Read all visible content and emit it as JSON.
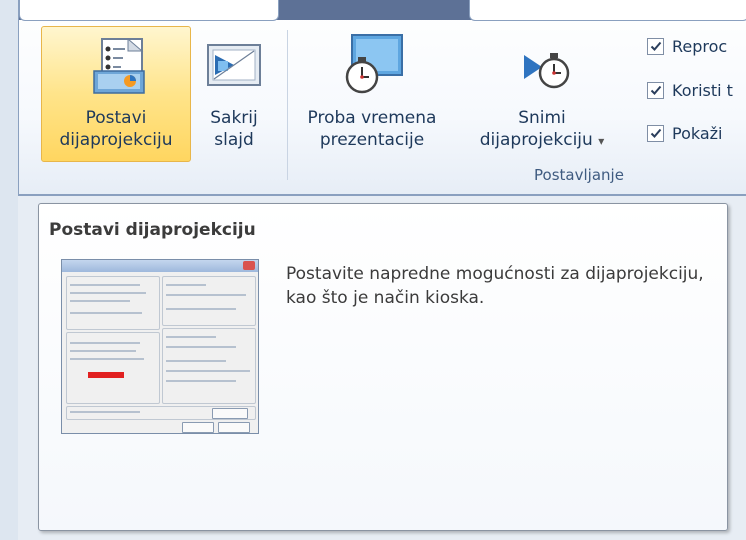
{
  "ribbon": {
    "buttons": [
      {
        "line1": "Postavi",
        "line2": "dijaprojekciju",
        "icon": "setup-slideshow-icon"
      },
      {
        "line1": "Sakrij",
        "line2": "slajd",
        "icon": "hide-slide-icon"
      },
      {
        "line1": "Proba vremena",
        "line2": "prezentacije",
        "icon": "rehearse-timings-icon"
      },
      {
        "line1": "Snimi",
        "line2": "dijaprojekciju",
        "dropdown": "▾",
        "icon": "record-slideshow-icon"
      }
    ],
    "checkboxes": [
      {
        "label": "Reproc",
        "checked": true
      },
      {
        "label": "Koristi t",
        "checked": true
      },
      {
        "label": "Pokaži",
        "checked": true
      }
    ],
    "group_label": "Postavljanje"
  },
  "tooltip": {
    "title": "Postavi dijaprojekciju",
    "description": "Postavite napredne mogućnosti za dijaprojekciju, kao što je način kioska.",
    "preview_image": "set-up-show-dialog-thumbnail"
  },
  "colors": {
    "frame": "#5d7196",
    "active_button": "#ffe48a",
    "label_text": "#1e395b"
  }
}
